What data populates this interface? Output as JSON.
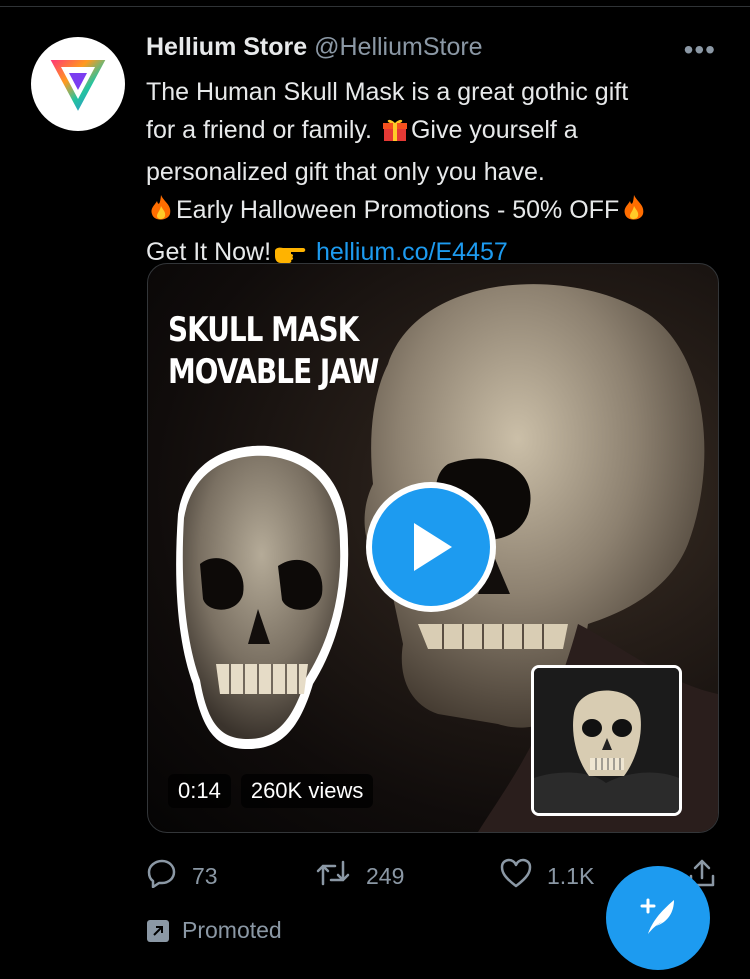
{
  "tweet": {
    "author_name": "Hellium Store",
    "author_handle": "@HelliumStore",
    "line1": "The Human Skull Mask is a great gothic gift",
    "line2_a": "for a friend or family. ",
    "line2_b": "Give yourself a",
    "line3": "personalized gift that only you have.",
    "line4": "Early Halloween Promotions - 50% OFF",
    "line5_a": "Get It Now!",
    "link": "hellium.co/E4457"
  },
  "media": {
    "title_line1": "SKULL MASK",
    "title_line2": "MOVABLE JAW",
    "duration": "0:14",
    "views": "260K views"
  },
  "actions": {
    "replies": "73",
    "retweets": "249",
    "likes": "1.1K"
  },
  "promoted_label": "Promoted",
  "colors": {
    "accent": "#1d9bf0",
    "muted": "#8b98a5",
    "background": "#000000"
  },
  "icons": [
    "more-icon",
    "reply-icon",
    "retweet-icon",
    "like-icon",
    "share-icon",
    "promoted-icon",
    "compose-icon",
    "play-icon"
  ]
}
